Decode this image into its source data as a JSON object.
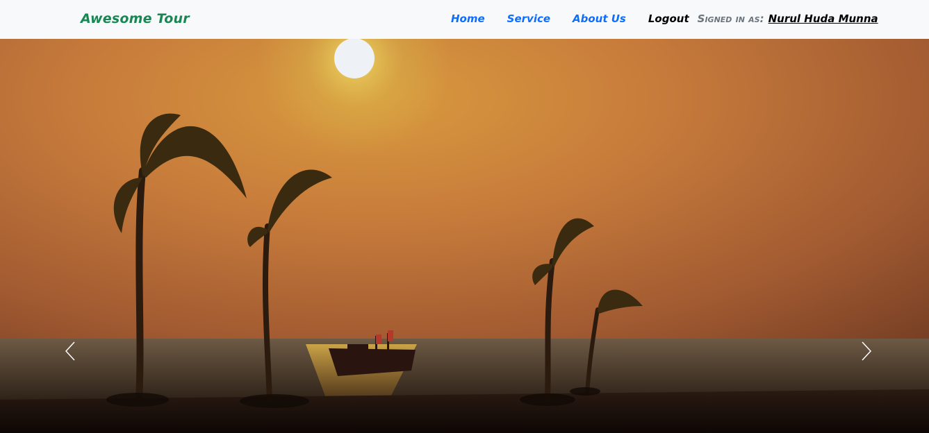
{
  "navbar": {
    "brand": "Awesome Tour",
    "links": [
      {
        "label": "Home"
      },
      {
        "label": "Service"
      },
      {
        "label": "About Us"
      }
    ],
    "logout": "Logout",
    "signed_in_label": "Signed in as:",
    "user_name": "Nurul Huda Munna"
  },
  "carousel": {
    "slide_description": "Sunset over the sea with palm trees and a boat",
    "prev_icon": "chevron-left-icon",
    "next_icon": "chevron-right-icon"
  },
  "colors": {
    "navbar_bg": "#f8f9fa",
    "brand": "#198754",
    "link": "#0d6efd",
    "muted": "#6c757d"
  }
}
